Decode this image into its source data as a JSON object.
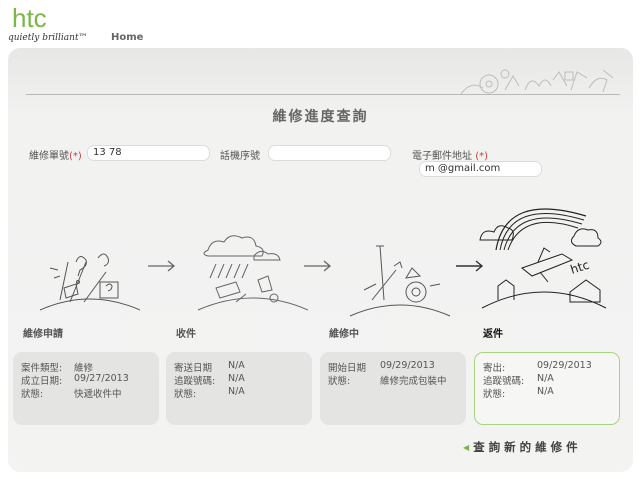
{
  "brand": {
    "name": "htc",
    "tagline": "quietly brilliant™"
  },
  "nav": {
    "home": "Home"
  },
  "page_title": "維修進度查詢",
  "form": {
    "repair_no_label": "維修單號",
    "required_mark": "(*)",
    "repair_no_value": "13            78",
    "phone_serial_label": "話機序號",
    "phone_serial_value": "",
    "email_label": "電子郵件地址",
    "email_value": "m        @gmail.com"
  },
  "stages": [
    {
      "title": "維修申請",
      "active": false,
      "rows": [
        {
          "k": "案件類型:",
          "v": "維修"
        },
        {
          "k": "成立日期:",
          "v": "09/27/2013"
        },
        {
          "k": "狀態:",
          "v": "快遞收件中"
        }
      ]
    },
    {
      "title": "收件",
      "active": false,
      "rows": [
        {
          "k": "寄送日期",
          "v": "N/A"
        },
        {
          "k": "追蹤號碼:",
          "v": "N/A"
        },
        {
          "k": "狀態:",
          "v": "N/A"
        }
      ]
    },
    {
      "title": "維修中",
      "active": false,
      "rows": [
        {
          "k": "開始日期",
          "v": "09/29/2013"
        },
        {
          "k": "狀態:",
          "v": "維修完成包裝中"
        }
      ]
    },
    {
      "title": "返件",
      "active": true,
      "rows": [
        {
          "k": "寄出:",
          "v": "09/29/2013"
        },
        {
          "k": "追蹤號碼:",
          "v": "N/A"
        },
        {
          "k": "狀態:",
          "v": "N/A"
        }
      ]
    }
  ],
  "query_new": "查詢新的維修件",
  "colors": {
    "brand_green": "#7ab648",
    "required_red": "#d23a3a",
    "panel_bg": "#f3f3f2"
  }
}
